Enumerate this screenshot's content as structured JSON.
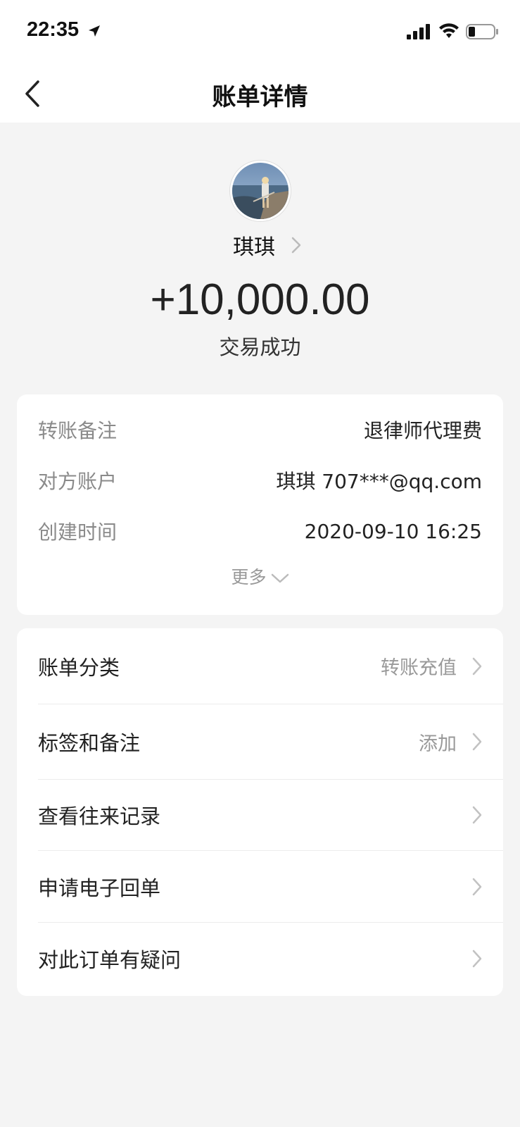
{
  "status_bar": {
    "time": "22:35",
    "icons": [
      "location-arrow-icon",
      "signal-icon",
      "wifi-icon",
      "battery-icon"
    ]
  },
  "nav": {
    "title": "账单详情",
    "back_icon": "chevron-left-icon"
  },
  "header": {
    "name": "琪琪",
    "amount": "+10,000.00",
    "status": "交易成功"
  },
  "details": {
    "rows": [
      {
        "label": "转账备注",
        "value": "退律师代理费"
      },
      {
        "label": "对方账户",
        "value": "琪琪 707***@qq.com"
      },
      {
        "label": "创建时间",
        "value": "2020-09-10 16:25"
      }
    ],
    "more_label": "更多"
  },
  "menu": {
    "items": [
      {
        "label": "账单分类",
        "value": "转账充值"
      },
      {
        "label": "标签和备注",
        "value": "添加"
      },
      {
        "label": "查看往来记录",
        "value": ""
      },
      {
        "label": "申请电子回单",
        "value": ""
      },
      {
        "label": "对此订单有疑问",
        "value": ""
      }
    ]
  },
  "colors": {
    "background": "#f4f4f4",
    "card": "#ffffff",
    "label_gray": "#8a8a8a",
    "text_dark": "#222222"
  }
}
